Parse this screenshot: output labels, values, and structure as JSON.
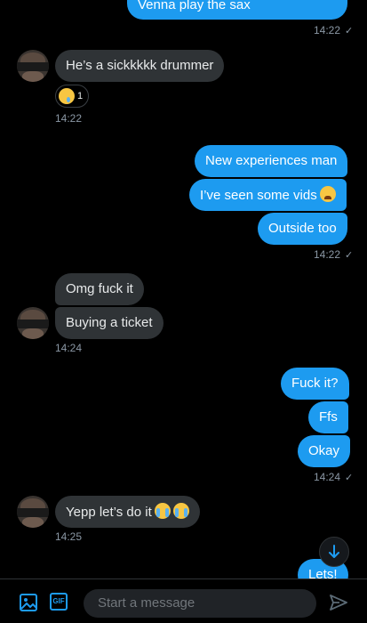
{
  "messages": {
    "top_partial": {
      "text": "Venna play the sax",
      "time": "14:22"
    },
    "m1": {
      "text": "He’s a sickkkkk drummer",
      "reaction_count": "1",
      "time": "14:22"
    },
    "m2": {
      "text": "New experiences man"
    },
    "m3": {
      "text": "I’ve seen some vids"
    },
    "m4": {
      "text": "Outside too",
      "time": "14:22"
    },
    "m5": {
      "text": "Omg fuck it"
    },
    "m6": {
      "text": "Buying a ticket",
      "time": "14:24"
    },
    "m7": {
      "text": "Fuck it?"
    },
    "m8": {
      "text": "Ffs"
    },
    "m9": {
      "text": "Okay",
      "time": "14:24"
    },
    "m10": {
      "text": "Yepp let’s do it",
      "time": "14:25"
    },
    "m11": {
      "text": "Lets!"
    }
  },
  "composer": {
    "placeholder": "Start a message",
    "gif_label": "GIF"
  },
  "colors": {
    "accent": "#1d9bf0",
    "incoming": "#2f3336",
    "background": "#000000"
  },
  "icons": [
    "image-icon",
    "gif-icon",
    "send-icon",
    "arrow-down-icon",
    "check-icon",
    "avatar"
  ]
}
